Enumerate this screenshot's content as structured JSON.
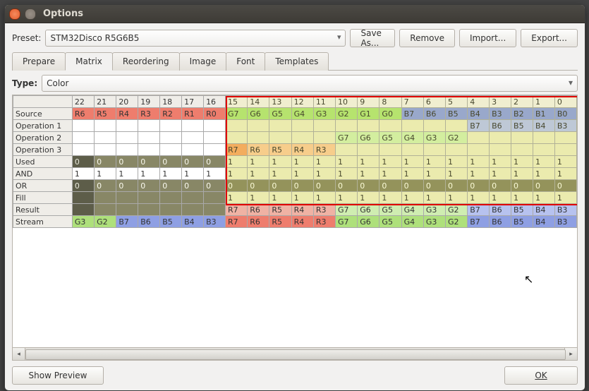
{
  "window": {
    "title": "Options"
  },
  "preset": {
    "label": "Preset:",
    "value": "STM32Disco R5G6B5",
    "buttons": {
      "save": "Save As...",
      "remove": "Remove",
      "import": "Import...",
      "export": "Export..."
    }
  },
  "tabs": [
    "Prepare",
    "Matrix",
    "Reordering",
    "Image",
    "Font",
    "Templates"
  ],
  "tabs_active_index": 1,
  "type": {
    "label": "Type:",
    "value": "Color"
  },
  "columns": [
    22,
    21,
    20,
    19,
    18,
    17,
    16,
    15,
    14,
    13,
    12,
    11,
    10,
    9,
    8,
    7,
    6,
    5,
    4,
    3,
    2,
    1,
    0
  ],
  "rows": [
    "Source",
    "Operation 1",
    "Operation 2",
    "Operation 3",
    "Used",
    "AND",
    "OR",
    "Fill",
    "Result",
    "Stream"
  ],
  "cells": {
    "Source": [
      {
        "t": "R6",
        "c": "c-red"
      },
      {
        "t": "R5",
        "c": "c-red"
      },
      {
        "t": "R4",
        "c": "c-red"
      },
      {
        "t": "R3",
        "c": "c-red"
      },
      {
        "t": "R2",
        "c": "c-red"
      },
      {
        "t": "R1",
        "c": "c-red"
      },
      {
        "t": "R0",
        "c": "c-red"
      },
      {
        "t": "G7",
        "c": "c-green"
      },
      {
        "t": "G6",
        "c": "c-green"
      },
      {
        "t": "G5",
        "c": "c-green"
      },
      {
        "t": "G4",
        "c": "c-green"
      },
      {
        "t": "G3",
        "c": "c-green"
      },
      {
        "t": "G2",
        "c": "c-green"
      },
      {
        "t": "G1",
        "c": "c-green"
      },
      {
        "t": "G0",
        "c": "c-green"
      },
      {
        "t": "B7",
        "c": "c-blue"
      },
      {
        "t": "B6",
        "c": "c-blue"
      },
      {
        "t": "B5",
        "c": "c-blue"
      },
      {
        "t": "B4",
        "c": "c-blue"
      },
      {
        "t": "B3",
        "c": "c-blue"
      },
      {
        "t": "B2",
        "c": "c-blue"
      },
      {
        "t": "B1",
        "c": "c-blue"
      },
      {
        "t": "B0",
        "c": "c-blue"
      }
    ],
    "Operation 1": [
      {
        "t": "",
        "c": "c-blank"
      },
      {
        "t": "",
        "c": "c-blank"
      },
      {
        "t": "",
        "c": "c-blank"
      },
      {
        "t": "",
        "c": "c-blank"
      },
      {
        "t": "",
        "c": "c-blank"
      },
      {
        "t": "",
        "c": "c-blank"
      },
      {
        "t": "",
        "c": "c-blank"
      },
      {
        "t": "",
        "c": "c-khaki"
      },
      {
        "t": "",
        "c": "c-khaki"
      },
      {
        "t": "",
        "c": "c-khaki"
      },
      {
        "t": "",
        "c": "c-khaki"
      },
      {
        "t": "",
        "c": "c-khaki"
      },
      {
        "t": "",
        "c": "c-khaki"
      },
      {
        "t": "",
        "c": "c-khaki"
      },
      {
        "t": "",
        "c": "c-khaki"
      },
      {
        "t": "",
        "c": "c-khaki"
      },
      {
        "t": "",
        "c": "c-khaki"
      },
      {
        "t": "",
        "c": "c-khaki"
      },
      {
        "t": "B7",
        "c": "c-blueL"
      },
      {
        "t": "B6",
        "c": "c-blueL"
      },
      {
        "t": "B5",
        "c": "c-blueL"
      },
      {
        "t": "B4",
        "c": "c-blueL"
      },
      {
        "t": "B3",
        "c": "c-blueL"
      }
    ],
    "Operation 2": [
      {
        "t": "",
        "c": "c-blank"
      },
      {
        "t": "",
        "c": "c-blank"
      },
      {
        "t": "",
        "c": "c-blank"
      },
      {
        "t": "",
        "c": "c-blank"
      },
      {
        "t": "",
        "c": "c-blank"
      },
      {
        "t": "",
        "c": "c-blank"
      },
      {
        "t": "",
        "c": "c-blank"
      },
      {
        "t": "",
        "c": "c-khaki"
      },
      {
        "t": "",
        "c": "c-khaki"
      },
      {
        "t": "",
        "c": "c-khaki"
      },
      {
        "t": "",
        "c": "c-khaki"
      },
      {
        "t": "",
        "c": "c-khaki"
      },
      {
        "t": "G7",
        "c": "c-greenL"
      },
      {
        "t": "G6",
        "c": "c-greenL"
      },
      {
        "t": "G5",
        "c": "c-greenL"
      },
      {
        "t": "G4",
        "c": "c-greenL"
      },
      {
        "t": "G3",
        "c": "c-greenL"
      },
      {
        "t": "G2",
        "c": "c-greenL"
      },
      {
        "t": "",
        "c": "c-khaki"
      },
      {
        "t": "",
        "c": "c-khaki"
      },
      {
        "t": "",
        "c": "c-khaki"
      },
      {
        "t": "",
        "c": "c-khaki"
      },
      {
        "t": "",
        "c": "c-khaki"
      }
    ],
    "Operation 3": [
      {
        "t": "",
        "c": "c-blank"
      },
      {
        "t": "",
        "c": "c-blank"
      },
      {
        "t": "",
        "c": "c-blank"
      },
      {
        "t": "",
        "c": "c-blank"
      },
      {
        "t": "",
        "c": "c-blank"
      },
      {
        "t": "",
        "c": "c-blank"
      },
      {
        "t": "",
        "c": "c-blank"
      },
      {
        "t": "R7",
        "c": "c-orange"
      },
      {
        "t": "R6",
        "c": "c-orangeL"
      },
      {
        "t": "R5",
        "c": "c-orangeL"
      },
      {
        "t": "R4",
        "c": "c-orangeL"
      },
      {
        "t": "R3",
        "c": "c-orangeL"
      },
      {
        "t": "",
        "c": "c-khaki"
      },
      {
        "t": "",
        "c": "c-khaki"
      },
      {
        "t": "",
        "c": "c-khaki"
      },
      {
        "t": "",
        "c": "c-khaki"
      },
      {
        "t": "",
        "c": "c-khaki"
      },
      {
        "t": "",
        "c": "c-khaki"
      },
      {
        "t": "",
        "c": "c-khaki"
      },
      {
        "t": "",
        "c": "c-khaki"
      },
      {
        "t": "",
        "c": "c-khaki"
      },
      {
        "t": "",
        "c": "c-khaki"
      },
      {
        "t": "",
        "c": "c-khaki"
      }
    ],
    "Used": [
      {
        "t": "0",
        "c": "c-kh0"
      },
      {
        "t": "0",
        "c": "c-kh1"
      },
      {
        "t": "0",
        "c": "c-kh1"
      },
      {
        "t": "0",
        "c": "c-kh1"
      },
      {
        "t": "0",
        "c": "c-kh1"
      },
      {
        "t": "0",
        "c": "c-kh1"
      },
      {
        "t": "0",
        "c": "c-kh1"
      },
      {
        "t": "1",
        "c": "c-kh2"
      },
      {
        "t": "1",
        "c": "c-kh2"
      },
      {
        "t": "1",
        "c": "c-kh2"
      },
      {
        "t": "1",
        "c": "c-kh2"
      },
      {
        "t": "1",
        "c": "c-kh2"
      },
      {
        "t": "1",
        "c": "c-kh2"
      },
      {
        "t": "1",
        "c": "c-kh2"
      },
      {
        "t": "1",
        "c": "c-kh2"
      },
      {
        "t": "1",
        "c": "c-kh2"
      },
      {
        "t": "1",
        "c": "c-kh2"
      },
      {
        "t": "1",
        "c": "c-kh2"
      },
      {
        "t": "1",
        "c": "c-kh2"
      },
      {
        "t": "1",
        "c": "c-kh2"
      },
      {
        "t": "1",
        "c": "c-kh2"
      },
      {
        "t": "1",
        "c": "c-kh2"
      },
      {
        "t": "1",
        "c": "c-kh2"
      }
    ],
    "AND": [
      {
        "t": "1",
        "c": "c-blank"
      },
      {
        "t": "1",
        "c": "c-blank"
      },
      {
        "t": "1",
        "c": "c-blank"
      },
      {
        "t": "1",
        "c": "c-blank"
      },
      {
        "t": "1",
        "c": "c-blank"
      },
      {
        "t": "1",
        "c": "c-blank"
      },
      {
        "t": "1",
        "c": "c-blank"
      },
      {
        "t": "1",
        "c": "c-kh2"
      },
      {
        "t": "1",
        "c": "c-kh2"
      },
      {
        "t": "1",
        "c": "c-kh2"
      },
      {
        "t": "1",
        "c": "c-kh2"
      },
      {
        "t": "1",
        "c": "c-kh2"
      },
      {
        "t": "1",
        "c": "c-kh2"
      },
      {
        "t": "1",
        "c": "c-kh2"
      },
      {
        "t": "1",
        "c": "c-kh2"
      },
      {
        "t": "1",
        "c": "c-kh2"
      },
      {
        "t": "1",
        "c": "c-kh2"
      },
      {
        "t": "1",
        "c": "c-kh2"
      },
      {
        "t": "1",
        "c": "c-kh2"
      },
      {
        "t": "1",
        "c": "c-kh2"
      },
      {
        "t": "1",
        "c": "c-kh2"
      },
      {
        "t": "1",
        "c": "c-kh2"
      },
      {
        "t": "1",
        "c": "c-kh2"
      }
    ],
    "OR": [
      {
        "t": "0",
        "c": "c-kh0"
      },
      {
        "t": "0",
        "c": "c-kh1"
      },
      {
        "t": "0",
        "c": "c-kh1"
      },
      {
        "t": "0",
        "c": "c-kh1"
      },
      {
        "t": "0",
        "c": "c-kh1"
      },
      {
        "t": "0",
        "c": "c-kh1"
      },
      {
        "t": "0",
        "c": "c-kh1"
      },
      {
        "t": "0",
        "c": "c-kh1"
      },
      {
        "t": "0",
        "c": "c-kh1"
      },
      {
        "t": "0",
        "c": "c-kh1"
      },
      {
        "t": "0",
        "c": "c-kh1"
      },
      {
        "t": "0",
        "c": "c-kh1"
      },
      {
        "t": "0",
        "c": "c-kh1"
      },
      {
        "t": "0",
        "c": "c-kh1"
      },
      {
        "t": "0",
        "c": "c-kh1"
      },
      {
        "t": "0",
        "c": "c-kh1"
      },
      {
        "t": "0",
        "c": "c-kh1"
      },
      {
        "t": "0",
        "c": "c-kh1"
      },
      {
        "t": "0",
        "c": "c-kh1"
      },
      {
        "t": "0",
        "c": "c-kh1"
      },
      {
        "t": "0",
        "c": "c-kh1"
      },
      {
        "t": "0",
        "c": "c-kh1"
      },
      {
        "t": "0",
        "c": "c-kh1"
      }
    ],
    "Fill": [
      {
        "t": "",
        "c": "c-kh0"
      },
      {
        "t": "",
        "c": "c-kh1"
      },
      {
        "t": "",
        "c": "c-kh1"
      },
      {
        "t": "",
        "c": "c-kh1"
      },
      {
        "t": "",
        "c": "c-kh1"
      },
      {
        "t": "",
        "c": "c-kh1"
      },
      {
        "t": "",
        "c": "c-kh1"
      },
      {
        "t": "1",
        "c": "c-kh2"
      },
      {
        "t": "1",
        "c": "c-kh2"
      },
      {
        "t": "1",
        "c": "c-kh2"
      },
      {
        "t": "1",
        "c": "c-kh2"
      },
      {
        "t": "1",
        "c": "c-kh2"
      },
      {
        "t": "1",
        "c": "c-kh2"
      },
      {
        "t": "1",
        "c": "c-kh2"
      },
      {
        "t": "1",
        "c": "c-kh2"
      },
      {
        "t": "1",
        "c": "c-kh2"
      },
      {
        "t": "1",
        "c": "c-kh2"
      },
      {
        "t": "1",
        "c": "c-kh2"
      },
      {
        "t": "1",
        "c": "c-kh2"
      },
      {
        "t": "1",
        "c": "c-kh2"
      },
      {
        "t": "1",
        "c": "c-kh2"
      },
      {
        "t": "1",
        "c": "c-kh2"
      },
      {
        "t": "1",
        "c": "c-kh2"
      }
    ],
    "Result": [
      {
        "t": "",
        "c": "c-kh0"
      },
      {
        "t": "",
        "c": "c-kh1"
      },
      {
        "t": "",
        "c": "c-kh1"
      },
      {
        "t": "",
        "c": "c-kh1"
      },
      {
        "t": "",
        "c": "c-kh1"
      },
      {
        "t": "",
        "c": "c-kh1"
      },
      {
        "t": "",
        "c": "c-kh1"
      },
      {
        "t": "R7",
        "c": "c-redL"
      },
      {
        "t": "R6",
        "c": "c-redL"
      },
      {
        "t": "R5",
        "c": "c-redL"
      },
      {
        "t": "R4",
        "c": "c-redL"
      },
      {
        "t": "R3",
        "c": "c-redL"
      },
      {
        "t": "G7",
        "c": "c-greenL"
      },
      {
        "t": "G6",
        "c": "c-greenL"
      },
      {
        "t": "G5",
        "c": "c-greenL"
      },
      {
        "t": "G4",
        "c": "c-greenL"
      },
      {
        "t": "G3",
        "c": "c-greenL"
      },
      {
        "t": "G2",
        "c": "c-greenL"
      },
      {
        "t": "B7",
        "c": "c-blueL"
      },
      {
        "t": "B6",
        "c": "c-blueL"
      },
      {
        "t": "B5",
        "c": "c-blueL"
      },
      {
        "t": "B4",
        "c": "c-blueL"
      },
      {
        "t": "B3",
        "c": "c-blueL"
      }
    ],
    "Stream": [
      {
        "t": "G3",
        "c": "c-green"
      },
      {
        "t": "G2",
        "c": "c-green"
      },
      {
        "t": "B7",
        "c": "c-blue"
      },
      {
        "t": "B6",
        "c": "c-blue"
      },
      {
        "t": "B5",
        "c": "c-blue"
      },
      {
        "t": "B4",
        "c": "c-blue"
      },
      {
        "t": "B3",
        "c": "c-blue"
      },
      {
        "t": "R7",
        "c": "c-red"
      },
      {
        "t": "R6",
        "c": "c-red"
      },
      {
        "t": "R5",
        "c": "c-red"
      },
      {
        "t": "R4",
        "c": "c-red"
      },
      {
        "t": "R3",
        "c": "c-red"
      },
      {
        "t": "G7",
        "c": "c-green"
      },
      {
        "t": "G6",
        "c": "c-green"
      },
      {
        "t": "G5",
        "c": "c-green"
      },
      {
        "t": "G4",
        "c": "c-green"
      },
      {
        "t": "G3",
        "c": "c-green"
      },
      {
        "t": "G2",
        "c": "c-green"
      },
      {
        "t": "B7",
        "c": "c-blue"
      },
      {
        "t": "B6",
        "c": "c-blue"
      },
      {
        "t": "B5",
        "c": "c-blue"
      },
      {
        "t": "B4",
        "c": "c-blue"
      },
      {
        "t": "B3",
        "c": "c-blue"
      }
    ]
  },
  "selection": {
    "from_col_index": 7,
    "to_col_index": 22,
    "from_row_index": -1,
    "to_row_index": 7
  },
  "bottom": {
    "show_preview": "Show Preview",
    "ok": "OK"
  }
}
